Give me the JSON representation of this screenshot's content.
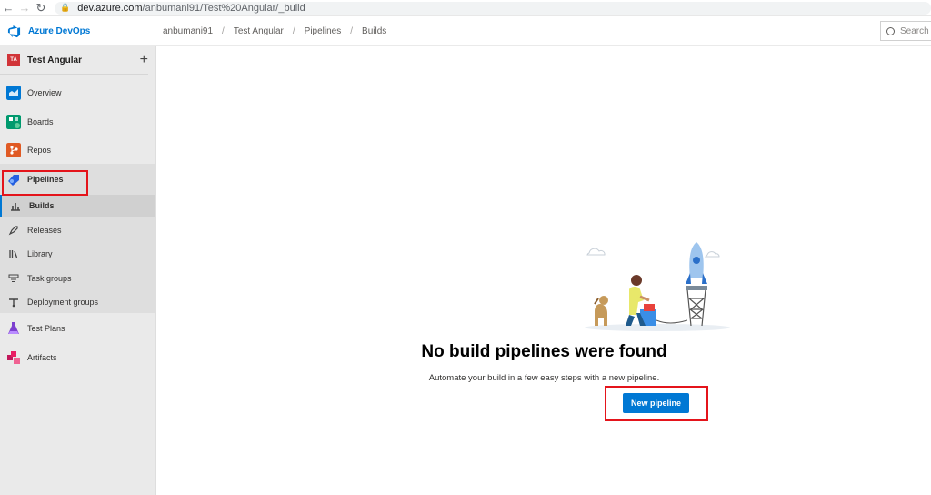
{
  "browser": {
    "url_host": "dev.azure.com",
    "url_path": "/anbumani91/Test%20Angular/_build"
  },
  "header": {
    "brand": "Azure DevOps",
    "breadcrumbs": [
      "anbumani91",
      "Test Angular",
      "Pipelines",
      "Builds"
    ],
    "search_placeholder": "Search"
  },
  "sidebar": {
    "project_initials": "TA",
    "project_name": "Test Angular",
    "items": [
      {
        "label": "Overview"
      },
      {
        "label": "Boards"
      },
      {
        "label": "Repos"
      },
      {
        "label": "Pipelines"
      },
      {
        "label": "Builds"
      },
      {
        "label": "Releases"
      },
      {
        "label": "Library"
      },
      {
        "label": "Task groups"
      },
      {
        "label": "Deployment groups"
      },
      {
        "label": "Test Plans"
      },
      {
        "label": "Artifacts"
      }
    ]
  },
  "main": {
    "heading": "No build pipelines were found",
    "subtext": "Automate your build in a few easy steps with a new pipeline.",
    "new_pipeline_label": "New pipeline"
  },
  "colors": {
    "accent": "#0078d4",
    "highlight_box": "#e4141b"
  }
}
